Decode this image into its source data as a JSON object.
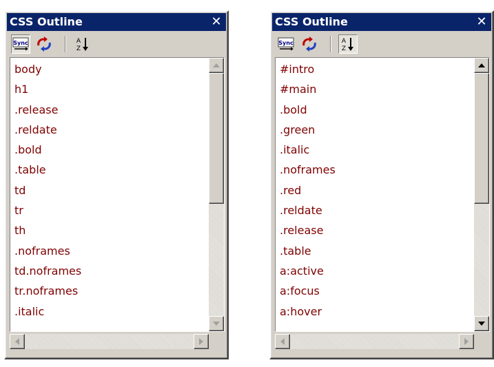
{
  "colors": {
    "titlebar_bg": "#0a246a",
    "titlebar_text": "#ffffff",
    "item_text": "#7f0000",
    "panel_bg": "#d4d0c8"
  },
  "icons": {
    "sync": "sync-icon",
    "refresh": "refresh-icon",
    "sort": "sort-az-icon",
    "close": "close-icon"
  },
  "toolbar": {
    "sync_label": "Sync",
    "close_glyph": "✕"
  },
  "panels": [
    {
      "title": "CSS Outline",
      "sort_pressed": false,
      "sync_pressed": true,
      "items": [
        "body",
        "h1",
        ".release",
        ".reldate",
        ".bold",
        ".table",
        "td",
        "tr",
        "th",
        ".noframes",
        "td.noframes",
        "tr.noframes",
        ".italic"
      ]
    },
    {
      "title": "CSS Outline",
      "sort_pressed": true,
      "sync_pressed": false,
      "items": [
        "#intro",
        "#main",
        ".bold",
        ".green",
        ".italic",
        ".noframes",
        ".red",
        ".reldate",
        ".release",
        ".table",
        "a:active",
        "a:focus",
        "a:hover"
      ]
    }
  ]
}
